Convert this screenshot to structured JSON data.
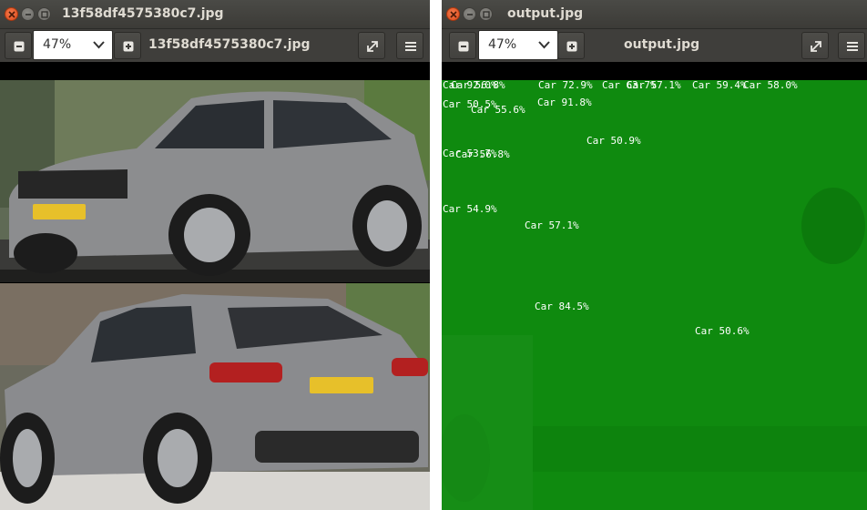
{
  "colors": {
    "titlebar": "#3c3b37",
    "close_button": "#e9541f",
    "overlay_green": "#0f8a0f"
  },
  "left_window": {
    "title": "13f58df4575380c7.jpg",
    "zoom": "47%",
    "filename": "13f58df4575380c7.jpg",
    "icons": [
      "close-icon",
      "minimize-icon",
      "maximize-icon",
      "zoom-out-icon",
      "chevron-down-icon",
      "zoom-in-icon",
      "fullscreen-icon",
      "menu-icon"
    ]
  },
  "right_window": {
    "title": "output.jpg",
    "zoom": "47%",
    "filename": "output.jpg"
  },
  "detections": [
    {
      "label": "Car 92.0%"
    },
    {
      "label": "Car 56.8%"
    },
    {
      "label": "Car 72.9%"
    },
    {
      "label": "Car 63.7%"
    },
    {
      "label": "Car 57.1%"
    },
    {
      "label": "Car 59.4%"
    },
    {
      "label": "Car 58.0%"
    },
    {
      "label": "Car 50.5%"
    },
    {
      "label": "Car 55.6%"
    },
    {
      "label": "Car 91.8%"
    },
    {
      "label": "Car 50.9%"
    },
    {
      "label": "Car 53.7%"
    },
    {
      "label": "Car 56.8%"
    },
    {
      "label": "Car 54.9%"
    },
    {
      "label": "Car 57.1%"
    },
    {
      "label": "Car 84.5%"
    },
    {
      "label": "Car 50.6%"
    }
  ]
}
